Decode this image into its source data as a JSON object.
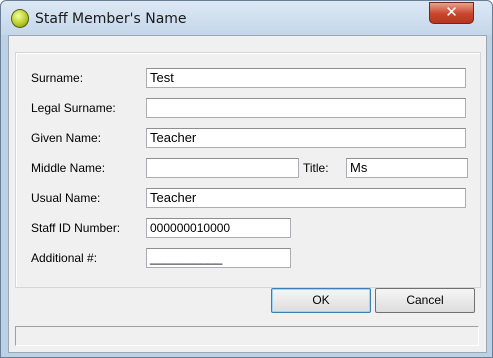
{
  "window": {
    "title": "Staff Member's Name",
    "close_glyph": "✕",
    "icon": "app-logo-icon"
  },
  "form": {
    "surname_label": "Surname:",
    "surname_value": "Test",
    "legal_surname_label": "Legal Surname:",
    "legal_surname_value": "",
    "given_name_label": "Given Name:",
    "given_name_value": "Teacher",
    "middle_name_label": "Middle Name:",
    "middle_name_value": "",
    "title_label": "Title:",
    "title_value": "Ms",
    "usual_name_label": "Usual Name:",
    "usual_name_value": "Teacher",
    "staff_id_label": "Staff ID Number:",
    "staff_id_value": "000000010000",
    "additional_label": "Additional #:",
    "additional_value": "__________"
  },
  "buttons": {
    "ok_label": "OK",
    "cancel_label": "Cancel"
  },
  "status": {
    "text": ""
  }
}
